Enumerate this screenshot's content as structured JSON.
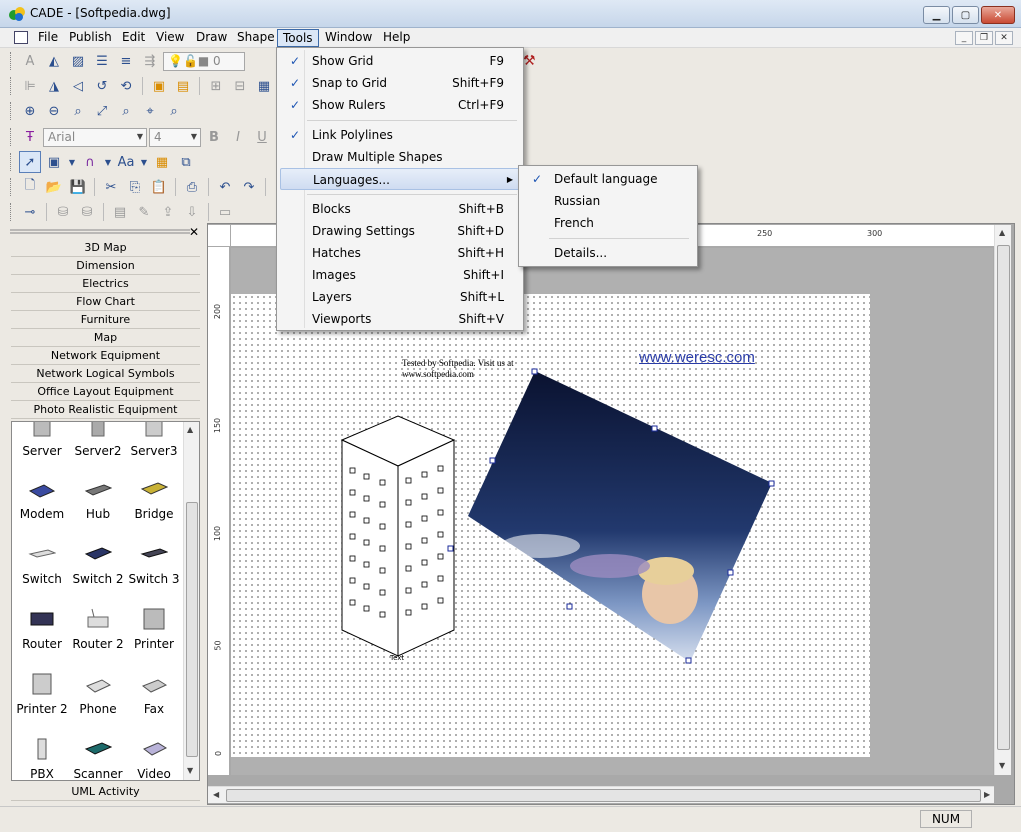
{
  "window": {
    "title": "CADE - [Softpedia.dwg]"
  },
  "menubar": {
    "items": [
      "File",
      "Publish",
      "Edit",
      "View",
      "Draw",
      "Shape",
      "Tools",
      "Window",
      "Help"
    ]
  },
  "toolbar": {
    "layer_value": "0",
    "font_name": "Arial",
    "font_size": "4",
    "bold": "B",
    "italic": "I",
    "underline": "U",
    "text_style": "Aa"
  },
  "tools_menu": {
    "items": [
      {
        "label": "Show Grid",
        "shortcut": "F9",
        "checked": true
      },
      {
        "label": "Snap to Grid",
        "shortcut": "Shift+F9",
        "checked": true
      },
      {
        "label": "Show Rulers",
        "shortcut": "Ctrl+F9",
        "checked": true
      },
      {
        "label": "Link Polylines",
        "shortcut": "",
        "checked": true
      },
      {
        "label": "Draw Multiple Shapes",
        "shortcut": "",
        "checked": false
      },
      {
        "label": "Languages...",
        "shortcut": "",
        "checked": false
      },
      {
        "label": "Blocks",
        "shortcut": "Shift+B",
        "checked": false
      },
      {
        "label": "Drawing Settings",
        "shortcut": "Shift+D",
        "checked": false
      },
      {
        "label": "Hatches",
        "shortcut": "Shift+H",
        "checked": false
      },
      {
        "label": "Images",
        "shortcut": "Shift+I",
        "checked": false
      },
      {
        "label": "Layers",
        "shortcut": "Shift+L",
        "checked": false
      },
      {
        "label": "Viewports",
        "shortcut": "Shift+V",
        "checked": false
      }
    ]
  },
  "languages_menu": {
    "items": [
      "Default language",
      "Russian",
      "French",
      "Details..."
    ]
  },
  "sidebar": {
    "categories": [
      "3D Map",
      "Dimension",
      "Electrics",
      "Flow Chart",
      "Furniture",
      "Map",
      "Network Equipment",
      "Network Logical Symbols",
      "Office Layout Equipment",
      "Photo Realistic Equipment"
    ],
    "shapes": [
      "Server",
      "Server2",
      "Server3",
      "Modem",
      "Hub",
      "Bridge",
      "Switch",
      "Switch 2",
      "Switch 3",
      "Router",
      "Router 2",
      "Printer",
      "Printer 2",
      "Phone",
      "Fax",
      "PBX",
      "Scanner",
      "Video"
    ],
    "bottom_category": "UML Activity"
  },
  "rulers": {
    "top": [
      "250",
      "300"
    ],
    "left": [
      "200",
      "150",
      "100",
      "50",
      "0"
    ]
  },
  "canvas": {
    "tested_text": "Tested by Softpedia. Visit us at www.softpedia.com",
    "link_text": "www.weresc.com",
    "building_label": "Text"
  },
  "status": {
    "num": "NUM"
  },
  "colors": {
    "menu_highlight": "#dbe7f7",
    "check": "#1d55b3",
    "link": "#2a3ca8"
  }
}
